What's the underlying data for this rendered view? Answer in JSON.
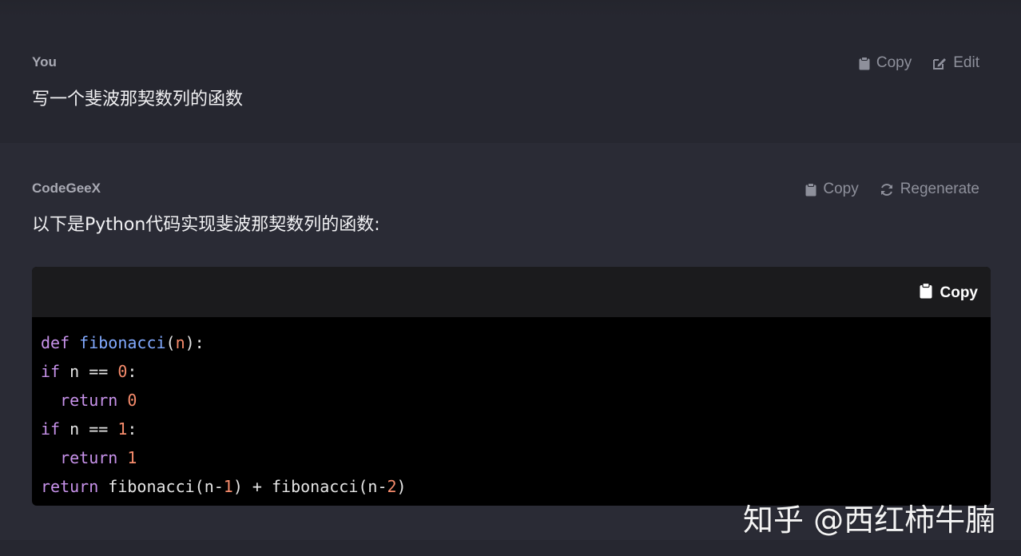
{
  "messages": {
    "user": {
      "author": "You",
      "text": "写一个斐波那契数列的函数",
      "actions": {
        "copy": "Copy",
        "edit": "Edit"
      }
    },
    "assistant": {
      "author": "CodeGeeX",
      "text": "以下是Python代码实现斐波那契数列的函数:",
      "actions": {
        "copy": "Copy",
        "regenerate": "Regenerate"
      }
    }
  },
  "code_block": {
    "copy_label": "Copy",
    "lines": [
      [
        {
          "t": "def",
          "c": "kw"
        },
        {
          "t": " ",
          "c": "plain"
        },
        {
          "t": "fibonacci",
          "c": "fn"
        },
        {
          "t": "(",
          "c": "plain"
        },
        {
          "t": "n",
          "c": "num"
        },
        {
          "t": "):",
          "c": "plain"
        }
      ],
      [
        {
          "t": "if",
          "c": "kw"
        },
        {
          "t": " n == ",
          "c": "plain"
        },
        {
          "t": "0",
          "c": "num"
        },
        {
          "t": ":",
          "c": "plain"
        }
      ],
      [
        {
          "t": "  ",
          "c": "plain"
        },
        {
          "t": "return",
          "c": "kw"
        },
        {
          "t": " ",
          "c": "plain"
        },
        {
          "t": "0",
          "c": "num"
        }
      ],
      [
        {
          "t": "if",
          "c": "kw"
        },
        {
          "t": " n == ",
          "c": "plain"
        },
        {
          "t": "1",
          "c": "num"
        },
        {
          "t": ":",
          "c": "plain"
        }
      ],
      [
        {
          "t": "  ",
          "c": "plain"
        },
        {
          "t": "return",
          "c": "kw"
        },
        {
          "t": " ",
          "c": "plain"
        },
        {
          "t": "1",
          "c": "num"
        }
      ],
      [
        {
          "t": "return",
          "c": "kw"
        },
        {
          "t": " fibonacci(n-",
          "c": "plain"
        },
        {
          "t": "1",
          "c": "num"
        },
        {
          "t": ") + fibonacci(n-",
          "c": "plain"
        },
        {
          "t": "2",
          "c": "num"
        },
        {
          "t": ")",
          "c": "plain"
        }
      ]
    ]
  },
  "watermark": "知乎 @西红柿牛腩",
  "colors": {
    "background": "#2a2b35",
    "user_message_bg": "#262730",
    "code_bg": "#000000",
    "code_header_bg": "#1b1b1d",
    "keyword": "#c792ea",
    "function": "#82aaff",
    "number": "#f78c6c",
    "action_text": "#8e909b"
  },
  "icons": {
    "copy": "clipboard-icon",
    "edit": "pencil-square-icon",
    "regenerate": "refresh-icon"
  }
}
